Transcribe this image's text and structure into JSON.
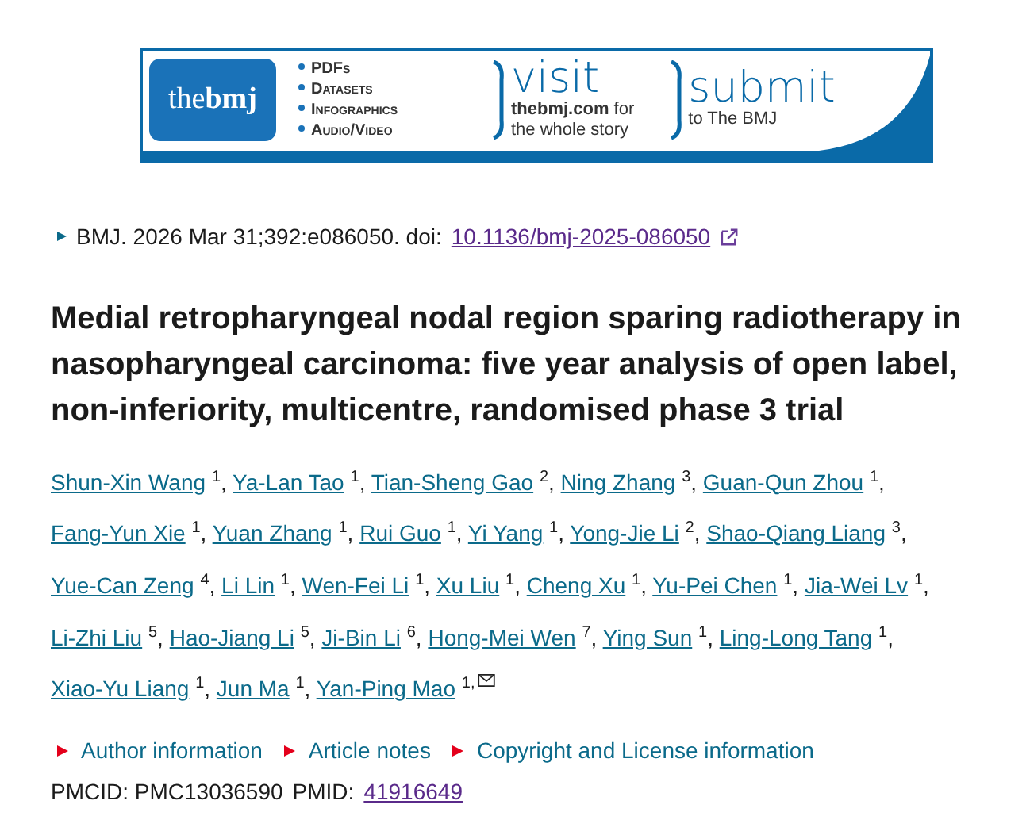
{
  "banner": {
    "logo": "the**bmj**",
    "features": [
      "PDFs",
      "Datasets",
      "Infographics",
      "Audio/Video"
    ],
    "visit": {
      "heading": "visit",
      "line_1": "**thebmj.com** for",
      "line_2": "the whole story"
    },
    "submit": {
      "heading": "submit",
      "line_1": "to The BMJ"
    }
  },
  "citation": {
    "journal": "BMJ. 2026 Mar 31;392:e086050. doi:",
    "doi": "10.1136/bmj-2025-086050"
  },
  "title": "Medial retropharyngeal nodal region sparing radiotherapy in nasopharyngeal carcinoma: five year analysis of open label, non-inferiority, multicentre, randomised phase 3 trial",
  "authors": [
    {
      "name": "Shun-Xin Wang",
      "affiliation": "1",
      "separator": ",",
      "email": false
    },
    {
      "name": "Ya-Lan Tao",
      "affiliation": "1",
      "separator": ",",
      "email": false
    },
    {
      "name": "Tian-Sheng Gao",
      "affiliation": "2",
      "separator": ",",
      "email": false
    },
    {
      "name": "Ning Zhang",
      "affiliation": "3",
      "separator": ",",
      "email": false
    },
    {
      "name": "Guan-Qun Zhou",
      "affiliation": "1",
      "separator": ",",
      "email": false
    },
    {
      "name": "Fang-Yun Xie",
      "affiliation": "1",
      "separator": ",",
      "email": false
    },
    {
      "name": "Yuan Zhang",
      "affiliation": "1",
      "separator": ",",
      "email": false
    },
    {
      "name": "Rui Guo",
      "affiliation": "1",
      "separator": ",",
      "email": false
    },
    {
      "name": "Yi Yang",
      "affiliation": "1",
      "separator": ",",
      "email": false
    },
    {
      "name": "Yong-Jie Li",
      "affiliation": "2",
      "separator": ",",
      "email": false
    },
    {
      "name": "Shao-Qiang Liang",
      "affiliation": "3",
      "separator": ",",
      "email": false
    },
    {
      "name": "Yue-Can Zeng",
      "affiliation": "4",
      "separator": ",",
      "email": false
    },
    {
      "name": "Li Lin",
      "affiliation": "1",
      "separator": ",",
      "email": false
    },
    {
      "name": "Wen-Fei Li",
      "affiliation": "1",
      "separator": ",",
      "email": false
    },
    {
      "name": "Xu Liu",
      "affiliation": "1",
      "separator": ",",
      "email": false
    },
    {
      "name": "Cheng Xu",
      "affiliation": "1",
      "separator": ",",
      "email": false
    },
    {
      "name": "Yu-Pei Chen",
      "affiliation": "1",
      "separator": ",",
      "email": false
    },
    {
      "name": "Jia-Wei Lv",
      "affiliation": "1",
      "separator": ",",
      "email": false
    },
    {
      "name": "Li-Zhi Liu",
      "affiliation": "5",
      "separator": ",",
      "email": false
    },
    {
      "name": "Hao-Jiang Li",
      "affiliation": "5",
      "separator": ",",
      "email": false
    },
    {
      "name": "Ji-Bin Li",
      "affiliation": "6",
      "separator": ",",
      "email": false
    },
    {
      "name": "Hong-Mei Wen",
      "affiliation": "7",
      "separator": ",",
      "email": false
    },
    {
      "name": "Ying Sun",
      "affiliation": "1",
      "separator": ",",
      "email": false
    },
    {
      "name": "Ling-Long Tang",
      "affiliation": "1",
      "separator": ",",
      "email": false
    },
    {
      "name": "Xiao-Yu Liang",
      "affiliation": "1",
      "separator": ",",
      "email": false
    },
    {
      "name": "Jun Ma",
      "affiliation": "1",
      "separator": ",",
      "email": false
    },
    {
      "name": "Yan-Ping Mao",
      "affiliation": "1,",
      "email": true
    }
  ],
  "sections": [
    {
      "label": "Author information",
      "expanded": false
    },
    {
      "label": "Article notes",
      "expanded": false
    },
    {
      "label": "Copyright and License information",
      "expanded": false
    }
  ],
  "ids": {
    "pmcid": "PMCID: PMC13036590",
    "pmid_label": "PMID:",
    "pmid": "41916649"
  }
}
